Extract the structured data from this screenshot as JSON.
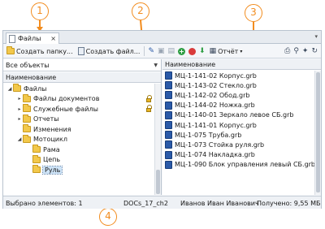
{
  "tab": {
    "label": "Файлы",
    "close": "×",
    "menu": "▾"
  },
  "toolbar": {
    "create_folder": "Создать папку...",
    "create_file": "Создать файл...",
    "report": "Отчёт",
    "report_arrow": "▾"
  },
  "left": {
    "filter": "Все объекты",
    "column": "Наименование",
    "tree": [
      {
        "label": "Файлы",
        "exp": "◢",
        "locked": false,
        "selected": false
      },
      {
        "label": "Файлы документов",
        "exp": "▸",
        "locked": true,
        "selected": false
      },
      {
        "label": "Служебные файлы",
        "exp": "▸",
        "locked": true,
        "selected": false
      },
      {
        "label": "Отчеты",
        "exp": "▸",
        "locked": false,
        "selected": false
      },
      {
        "label": "Изменения",
        "exp": "",
        "locked": false,
        "selected": false
      },
      {
        "label": "Мотоцикл",
        "exp": "◢",
        "locked": false,
        "selected": false
      },
      {
        "label": "Рама",
        "exp": "",
        "locked": false,
        "selected": false
      },
      {
        "label": "Цепь",
        "exp": "",
        "locked": false,
        "selected": false
      },
      {
        "label": "Руль",
        "exp": "",
        "locked": false,
        "selected": true
      }
    ]
  },
  "right": {
    "column": "Наименование",
    "files": [
      "МЦ-1-141-02 Корпус.grb",
      "МЦ-1-143-02 Стекло.grb",
      "МЦ-1-142-02 Обод.grb",
      "МЦ-1-144-02 Ножка.grb",
      "МЦ-1-140-01 Зеркало левое СБ.grb",
      "МЦ-1-141-01 Корпус.grb",
      "МЦ-1-075 Труба.grb",
      "МЦ-1-073 Стойка руля.grb",
      "МЦ-1-074 Накладка.grb",
      "МЦ-1-090 Блок управления левый СБ.grb"
    ]
  },
  "status": {
    "selected": "Выбрано элементов: 1",
    "db": "DOCs_17_ch2",
    "user": "Иванов Иван Иванович",
    "received": "Получено: 9,55 МБ"
  },
  "callouts": [
    "1",
    "2",
    "3",
    "4"
  ],
  "colors": {
    "callout": "#f28c1e",
    "folder": "#f2c84b",
    "grb": "#2b5aa8"
  }
}
